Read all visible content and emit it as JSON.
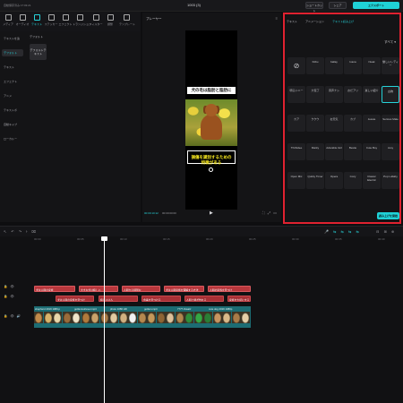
{
  "titlebar": {
    "left": "自動保存済み 17:03:21",
    "title": "1003 (3)",
    "shortcut": "ショートカット",
    "share": "シェア",
    "export": "エクスポート"
  },
  "toolbar": {
    "tabs": [
      {
        "label": "メディア"
      },
      {
        "label": "オーディオ"
      },
      {
        "label": "テキスト"
      },
      {
        "label": "ステッカー"
      },
      {
        "label": "エフェクト"
      },
      {
        "label": "トランジション"
      },
      {
        "label": "フィルター"
      },
      {
        "label": "調整"
      },
      {
        "label": "テンプレート"
      }
    ]
  },
  "sidebar": {
    "items": [
      {
        "label": "テキストを追"
      },
      {
        "label": "デフォルト"
      },
      {
        "label": "テキスト"
      },
      {
        "label": "エフェクト"
      },
      {
        "label": "アニメ"
      },
      {
        "label": "テキストボ"
      },
      {
        "label": "自動キャプ"
      },
      {
        "label": "ローカルー"
      }
    ],
    "default_label": "デフォルト",
    "default_card": "デフォルトテキスト"
  },
  "player": {
    "title": "プレーヤー",
    "caption_top": "犬の毛は脂肪と脂肪に",
    "caption_bottom": "損傷を識別するための特徴がある",
    "time_current": "00:00:10:12",
    "time_total": "00:00:00:00"
  },
  "rightpanel": {
    "tabs": [
      "テキスト",
      "アニメーション",
      "テキスト読み上げ"
    ],
    "all_label": "すべて ▾",
    "cells": [
      "⊘",
      "Kitbu",
      "ballay",
      "Ivana",
      "Nuak",
      "優しいレディー",
      "明るいニー",
      "大包丁",
      "音声ナシ",
      "おだアリ",
      "楽しい紹介",
      "古物",
      "カア",
      "ククウ",
      "お天気",
      "カブ",
      "Jessie",
      "Serious Male",
      "Chill Girl",
      "Thribidee",
      "Marky",
      "Adorable Girl",
      "Bestie",
      "Cute Boy",
      "Josy",
      "College-core",
      "Open Mic",
      "Quirky Timer",
      "Opera",
      "Cozy",
      "Classic Electric",
      "Pop Lullaby",
      "Empathetic Female"
    ],
    "add_label": "読み上げを開始"
  },
  "timeline": {
    "ticks": [
      "00:00",
      "00:05",
      "00:10",
      "00:15",
      "00:20",
      "00:25",
      "00:30",
      "00:35",
      "00:40"
    ],
    "row1": [
      "犬は人間の家族",
      "大きな犬は嬉しい",
      "人間から特別な",
      "犬は人間家族を理解する方法",
      "人間の家族を見つけ"
    ],
    "row2": [
      "犬は人間の家族を見つけ",
      "嬉しいは人",
      "食事を見つける",
      "人間と絆が作れる",
      "家族を大切にする"
    ],
    "video_labels": [
      "shepherd 2019 1080.p",
      "goldenretriever.mp4",
      "photo 1080 HD",
      "golden.mp4",
      "7777 Zusatz",
      "cute dog 2019 1080p"
    ]
  }
}
